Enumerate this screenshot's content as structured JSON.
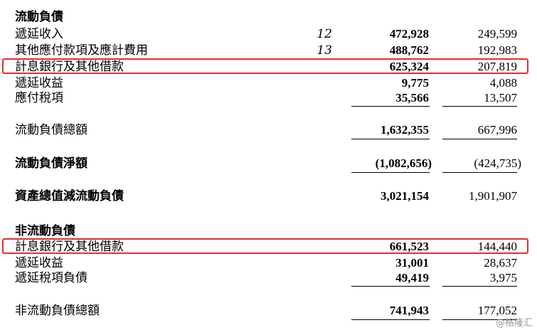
{
  "sections": {
    "current_header": "流動負債",
    "noncurrent_header": "非流動負債"
  },
  "rows": {
    "r1": {
      "label": "遞延收入",
      "note": "12",
      "v1": "472,928",
      "v2": "249,599"
    },
    "r2": {
      "label": "其他應付款項及應計費用",
      "note": "13",
      "v1": "488,762",
      "v2": "192,983"
    },
    "r3": {
      "label": "計息銀行及其他借款",
      "v1": "625,324",
      "v2": "207,819"
    },
    "r4": {
      "label": "遞延收益",
      "v1": "9,775",
      "v2": "4,088"
    },
    "r5": {
      "label": "應付稅項",
      "v1": "35,566",
      "v2": "13,507"
    },
    "r6": {
      "label": "流動負債總額",
      "v1": "1,632,355",
      "v2": "667,996"
    },
    "r7": {
      "label": "流動負債淨額",
      "v1": "(1,082,656)",
      "v2": "(424,735)"
    },
    "r8": {
      "label": "資產總值減流動負債",
      "v1": "3,021,154",
      "v2": "1,901,907"
    },
    "r9": {
      "label": "計息銀行及其他借款",
      "v1": "661,523",
      "v2": "144,440"
    },
    "r10": {
      "label": "遞延收益",
      "v1": "31,001",
      "v2": "28,637"
    },
    "r11": {
      "label": "遞延稅項負債",
      "v1": "49,419",
      "v2": "3,975"
    },
    "r12": {
      "label": "非流動負債總額",
      "v1": "741,943",
      "v2": "177,052"
    }
  },
  "watermark": "@格隆汇",
  "colors": {
    "highlight_box": "#e1302c"
  }
}
